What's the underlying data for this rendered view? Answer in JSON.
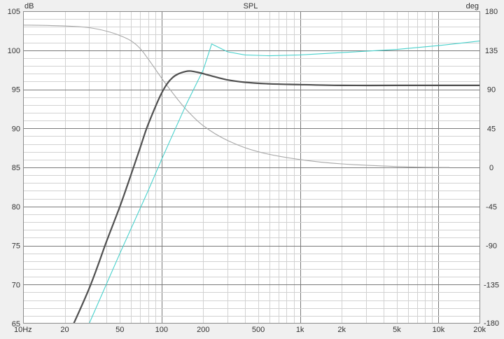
{
  "chart_data": {
    "type": "line",
    "title": "SPL",
    "y_left_unit": "dB",
    "y_right_unit": "deg",
    "x_scale": "log",
    "xlim": [
      10,
      20000
    ],
    "ylim_left": [
      65,
      105
    ],
    "ylim_right": [
      -180,
      180
    ],
    "grid": true,
    "x_ticks": [
      {
        "value": 10,
        "label": "10Hz"
      },
      {
        "value": 20,
        "label": "20"
      },
      {
        "value": 50,
        "label": "50"
      },
      {
        "value": 100,
        "label": "100"
      },
      {
        "value": 200,
        "label": "200"
      },
      {
        "value": 500,
        "label": "500"
      },
      {
        "value": 1000,
        "label": "1k"
      },
      {
        "value": 2000,
        "label": "2k"
      },
      {
        "value": 5000,
        "label": "5k"
      },
      {
        "value": 10000,
        "label": "10k"
      },
      {
        "value": 20000,
        "label": "20k"
      }
    ],
    "y_left_ticks": [
      {
        "value": 105,
        "label": "105"
      },
      {
        "value": 100,
        "label": "100"
      },
      {
        "value": 95,
        "label": "95"
      },
      {
        "value": 90,
        "label": "90"
      },
      {
        "value": 85,
        "label": "85"
      },
      {
        "value": 80,
        "label": "80"
      },
      {
        "value": 75,
        "label": "75"
      },
      {
        "value": 70,
        "label": "70"
      },
      {
        "value": 65,
        "label": "65"
      }
    ],
    "y_right_ticks": [
      {
        "value": 180,
        "label": "180"
      },
      {
        "value": 135,
        "label": "135"
      },
      {
        "value": 90,
        "label": "90"
      },
      {
        "value": 45,
        "label": "45"
      },
      {
        "value": 0,
        "label": "0"
      },
      {
        "value": -45,
        "label": "-45"
      },
      {
        "value": -90,
        "label": "-90"
      },
      {
        "value": -135,
        "label": "-135"
      },
      {
        "value": -180,
        "label": "-180"
      }
    ],
    "series": [
      {
        "axis": "left",
        "color": "#505050",
        "points": [
          [
            20,
            62.5
          ],
          [
            30,
            69.5
          ],
          [
            40,
            75.5
          ],
          [
            50,
            80.0
          ],
          [
            60,
            84.0
          ],
          [
            70,
            87.5
          ],
          [
            80,
            90.5
          ],
          [
            100,
            94.5
          ],
          [
            120,
            96.5
          ],
          [
            150,
            97.3
          ],
          [
            180,
            97.2
          ],
          [
            220,
            96.8
          ],
          [
            300,
            96.2
          ],
          [
            400,
            95.9
          ],
          [
            600,
            95.7
          ],
          [
            1000,
            95.6
          ],
          [
            2000,
            95.5
          ],
          [
            5000,
            95.5
          ],
          [
            10000,
            95.5
          ],
          [
            20000,
            95.5
          ]
        ]
      },
      {
        "axis": "left",
        "color": "#48d1cc",
        "points": [
          [
            30,
            65
          ],
          [
            50,
            74.0
          ],
          [
            80,
            82.0
          ],
          [
            100,
            86.0
          ],
          [
            150,
            93.0
          ],
          [
            200,
            97.5
          ],
          [
            230,
            100.8
          ],
          [
            300,
            99.8
          ],
          [
            400,
            99.4
          ],
          [
            600,
            99.3
          ],
          [
            1000,
            99.4
          ],
          [
            2000,
            99.7
          ],
          [
            5000,
            100.1
          ],
          [
            10000,
            100.6
          ],
          [
            20000,
            101.2
          ]
        ]
      },
      {
        "axis": "right",
        "color": "#a8a8a8",
        "points": [
          [
            10,
            164
          ],
          [
            20,
            163
          ],
          [
            30,
            161
          ],
          [
            40,
            157
          ],
          [
            50,
            152
          ],
          [
            60,
            146
          ],
          [
            70,
            137
          ],
          [
            80,
            125
          ],
          [
            100,
            103
          ],
          [
            120,
            86
          ],
          [
            150,
            67
          ],
          [
            200,
            48
          ],
          [
            300,
            31
          ],
          [
            500,
            18
          ],
          [
            1000,
            9
          ],
          [
            2000,
            4
          ],
          [
            5000,
            1
          ],
          [
            10000,
            0
          ],
          [
            12000,
            0
          ]
        ]
      }
    ]
  }
}
